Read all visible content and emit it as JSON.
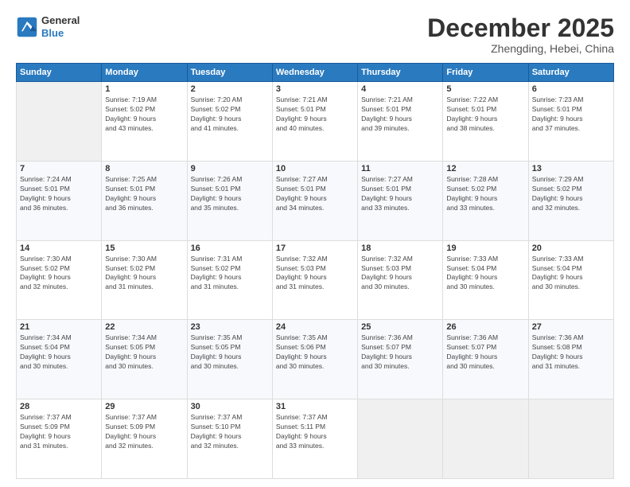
{
  "logo": {
    "line1": "General",
    "line2": "Blue"
  },
  "header": {
    "month": "December 2025",
    "location": "Zhengding, Hebei, China"
  },
  "weekdays": [
    "Sunday",
    "Monday",
    "Tuesday",
    "Wednesday",
    "Thursday",
    "Friday",
    "Saturday"
  ],
  "weeks": [
    [
      {
        "day": "",
        "info": ""
      },
      {
        "day": "1",
        "info": "Sunrise: 7:19 AM\nSunset: 5:02 PM\nDaylight: 9 hours\nand 43 minutes."
      },
      {
        "day": "2",
        "info": "Sunrise: 7:20 AM\nSunset: 5:02 PM\nDaylight: 9 hours\nand 41 minutes."
      },
      {
        "day": "3",
        "info": "Sunrise: 7:21 AM\nSunset: 5:01 PM\nDaylight: 9 hours\nand 40 minutes."
      },
      {
        "day": "4",
        "info": "Sunrise: 7:21 AM\nSunset: 5:01 PM\nDaylight: 9 hours\nand 39 minutes."
      },
      {
        "day": "5",
        "info": "Sunrise: 7:22 AM\nSunset: 5:01 PM\nDaylight: 9 hours\nand 38 minutes."
      },
      {
        "day": "6",
        "info": "Sunrise: 7:23 AM\nSunset: 5:01 PM\nDaylight: 9 hours\nand 37 minutes."
      }
    ],
    [
      {
        "day": "7",
        "info": "Sunrise: 7:24 AM\nSunset: 5:01 PM\nDaylight: 9 hours\nand 36 minutes."
      },
      {
        "day": "8",
        "info": "Sunrise: 7:25 AM\nSunset: 5:01 PM\nDaylight: 9 hours\nand 36 minutes."
      },
      {
        "day": "9",
        "info": "Sunrise: 7:26 AM\nSunset: 5:01 PM\nDaylight: 9 hours\nand 35 minutes."
      },
      {
        "day": "10",
        "info": "Sunrise: 7:27 AM\nSunset: 5:01 PM\nDaylight: 9 hours\nand 34 minutes."
      },
      {
        "day": "11",
        "info": "Sunrise: 7:27 AM\nSunset: 5:01 PM\nDaylight: 9 hours\nand 33 minutes."
      },
      {
        "day": "12",
        "info": "Sunrise: 7:28 AM\nSunset: 5:02 PM\nDaylight: 9 hours\nand 33 minutes."
      },
      {
        "day": "13",
        "info": "Sunrise: 7:29 AM\nSunset: 5:02 PM\nDaylight: 9 hours\nand 32 minutes."
      }
    ],
    [
      {
        "day": "14",
        "info": "Sunrise: 7:30 AM\nSunset: 5:02 PM\nDaylight: 9 hours\nand 32 minutes."
      },
      {
        "day": "15",
        "info": "Sunrise: 7:30 AM\nSunset: 5:02 PM\nDaylight: 9 hours\nand 31 minutes."
      },
      {
        "day": "16",
        "info": "Sunrise: 7:31 AM\nSunset: 5:02 PM\nDaylight: 9 hours\nand 31 minutes."
      },
      {
        "day": "17",
        "info": "Sunrise: 7:32 AM\nSunset: 5:03 PM\nDaylight: 9 hours\nand 31 minutes."
      },
      {
        "day": "18",
        "info": "Sunrise: 7:32 AM\nSunset: 5:03 PM\nDaylight: 9 hours\nand 30 minutes."
      },
      {
        "day": "19",
        "info": "Sunrise: 7:33 AM\nSunset: 5:04 PM\nDaylight: 9 hours\nand 30 minutes."
      },
      {
        "day": "20",
        "info": "Sunrise: 7:33 AM\nSunset: 5:04 PM\nDaylight: 9 hours\nand 30 minutes."
      }
    ],
    [
      {
        "day": "21",
        "info": "Sunrise: 7:34 AM\nSunset: 5:04 PM\nDaylight: 9 hours\nand 30 minutes."
      },
      {
        "day": "22",
        "info": "Sunrise: 7:34 AM\nSunset: 5:05 PM\nDaylight: 9 hours\nand 30 minutes."
      },
      {
        "day": "23",
        "info": "Sunrise: 7:35 AM\nSunset: 5:05 PM\nDaylight: 9 hours\nand 30 minutes."
      },
      {
        "day": "24",
        "info": "Sunrise: 7:35 AM\nSunset: 5:06 PM\nDaylight: 9 hours\nand 30 minutes."
      },
      {
        "day": "25",
        "info": "Sunrise: 7:36 AM\nSunset: 5:07 PM\nDaylight: 9 hours\nand 30 minutes."
      },
      {
        "day": "26",
        "info": "Sunrise: 7:36 AM\nSunset: 5:07 PM\nDaylight: 9 hours\nand 30 minutes."
      },
      {
        "day": "27",
        "info": "Sunrise: 7:36 AM\nSunset: 5:08 PM\nDaylight: 9 hours\nand 31 minutes."
      }
    ],
    [
      {
        "day": "28",
        "info": "Sunrise: 7:37 AM\nSunset: 5:09 PM\nDaylight: 9 hours\nand 31 minutes."
      },
      {
        "day": "29",
        "info": "Sunrise: 7:37 AM\nSunset: 5:09 PM\nDaylight: 9 hours\nand 32 minutes."
      },
      {
        "day": "30",
        "info": "Sunrise: 7:37 AM\nSunset: 5:10 PM\nDaylight: 9 hours\nand 32 minutes."
      },
      {
        "day": "31",
        "info": "Sunrise: 7:37 AM\nSunset: 5:11 PM\nDaylight: 9 hours\nand 33 minutes."
      },
      {
        "day": "",
        "info": ""
      },
      {
        "day": "",
        "info": ""
      },
      {
        "day": "",
        "info": ""
      }
    ]
  ]
}
